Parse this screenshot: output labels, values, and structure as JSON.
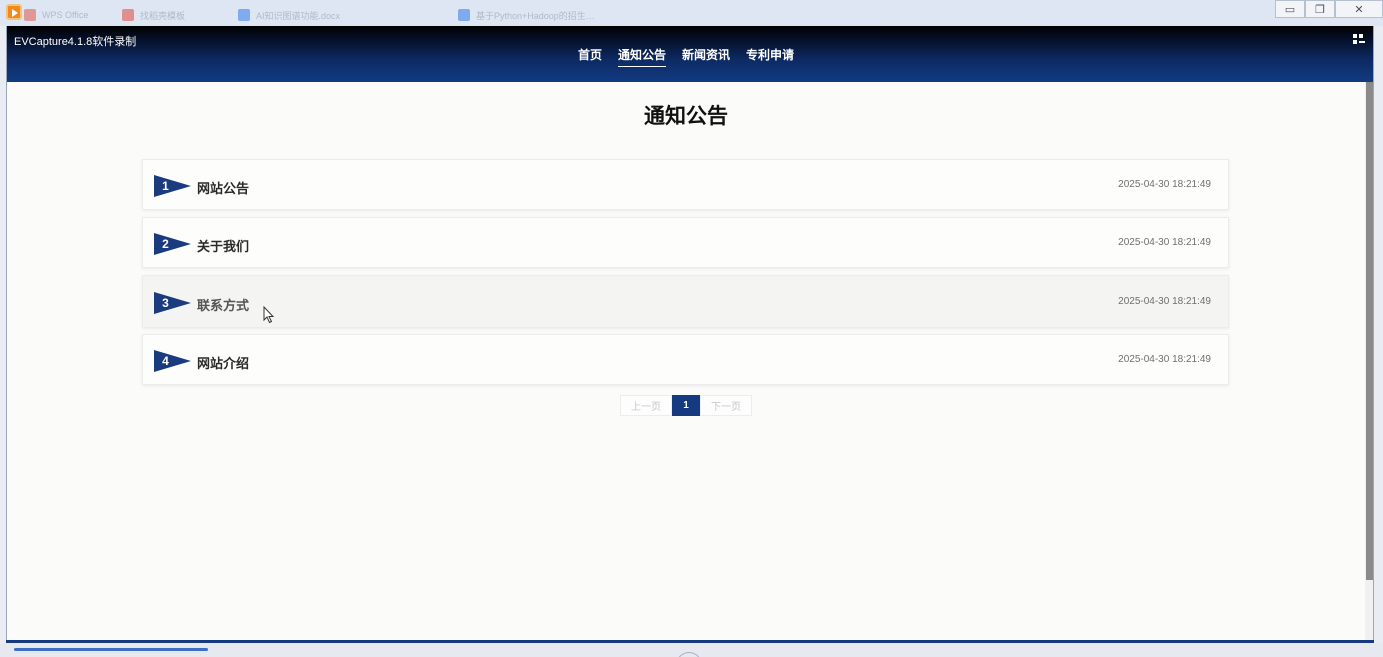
{
  "host": {
    "tabs": [
      "WPS Office",
      "找稻壳模板",
      "AI知识图谱功能.docx",
      "基于Python+Hadoop的招生…"
    ],
    "window_buttons": {
      "minimize": "▭",
      "restore": "❐",
      "close": "✕"
    }
  },
  "app": {
    "title": "EVCapture4.1.8软件录制",
    "nav": [
      {
        "label": "首页",
        "active": false
      },
      {
        "label": "通知公告",
        "active": true
      },
      {
        "label": "新闻资讯",
        "active": false
      },
      {
        "label": "专利申请",
        "active": false
      }
    ]
  },
  "page": {
    "title": "通知公告",
    "notices": [
      {
        "num": "1",
        "title": "网站公告",
        "date": "2025-04-30 18:21:49"
      },
      {
        "num": "2",
        "title": "关于我们",
        "date": "2025-04-30 18:21:49"
      },
      {
        "num": "3",
        "title": "联系方式",
        "date": "2025-04-30 18:21:49"
      },
      {
        "num": "4",
        "title": "网站介绍",
        "date": "2025-04-30 18:21:49"
      }
    ],
    "pagination": {
      "prev": "上一页",
      "current": "1",
      "next": "下一页"
    }
  },
  "colors": {
    "nav_gradient_top": "#000000",
    "nav_gradient_bottom": "#123b83",
    "accent": "#163a80",
    "flag": "#1a3b7e"
  },
  "icons": {
    "flag": "pennant-flag-icon",
    "grid": "grid-menu-icon",
    "cursor": "mouse-pointer-icon"
  }
}
